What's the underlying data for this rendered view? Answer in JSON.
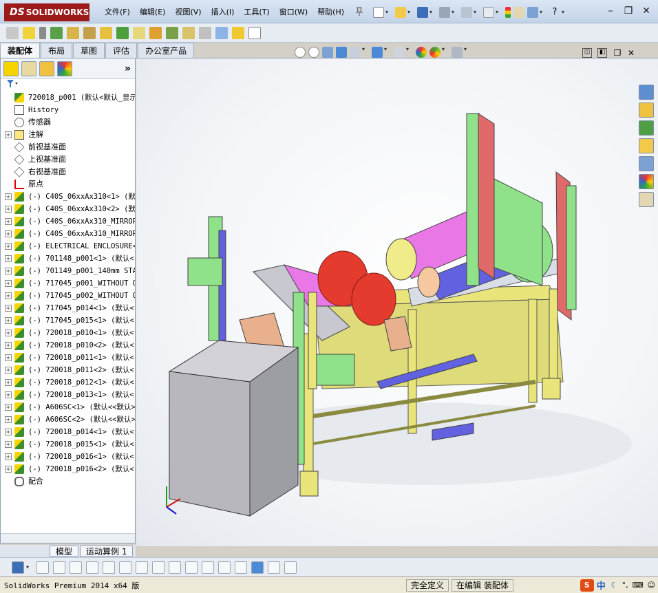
{
  "app": {
    "logo_text": "SOLIDWORKS",
    "menu": [
      "文件(F)",
      "编辑(E)",
      "视图(V)",
      "插入(I)",
      "工具(T)",
      "窗口(W)",
      "帮助(H)"
    ]
  },
  "tabs": [
    "装配体",
    "布局",
    "草图",
    "评估",
    "办公室产品"
  ],
  "tree": {
    "root_label": "720018_p001 (默认<默认_显示状",
    "items": [
      {
        "label": "History",
        "icon": "history-icon",
        "expand": ""
      },
      {
        "label": "传感器",
        "icon": "sensor-icon",
        "expand": ""
      },
      {
        "label": "注解",
        "icon": "annotation-icon",
        "expand": "+"
      },
      {
        "label": "前视基准面",
        "icon": "plane-icon",
        "expand": ""
      },
      {
        "label": "上视基准面",
        "icon": "plane-icon",
        "expand": ""
      },
      {
        "label": "右视基准面",
        "icon": "plane-icon",
        "expand": ""
      },
      {
        "label": "原点",
        "icon": "origin-icon",
        "expand": ""
      },
      {
        "label": "(-) C40S_06xxAx310<1> (默认",
        "icon": "part-icon",
        "expand": "+"
      },
      {
        "label": "(-) C40S_06xxAx310<2> (默认",
        "icon": "part-icon",
        "expand": "+"
      },
      {
        "label": "(-) C40S_06xxAx310_MIRROR<",
        "icon": "part-icon",
        "expand": "+"
      },
      {
        "label": "(-) C40S_06xxAx310_MIRROR<",
        "icon": "part-icon",
        "expand": "+"
      },
      {
        "label": "(-) ELECTRICAL ENCLOSURE<",
        "icon": "part-icon",
        "expand": "+"
      },
      {
        "label": "(-) 701148_p001<1> (默认<",
        "icon": "part-icon",
        "expand": "+"
      },
      {
        "label": "(-) 701149_p001_140mm STAC",
        "icon": "part-icon",
        "expand": "+"
      },
      {
        "label": "(-) 717045_p001_WITHOUT OI",
        "icon": "part-icon",
        "expand": "+"
      },
      {
        "label": "(-) 717045_p002_WITHOUT OI",
        "icon": "part-icon",
        "expand": "+"
      },
      {
        "label": "(-) 717045_p014<1> (默认<",
        "icon": "part-icon",
        "expand": "+"
      },
      {
        "label": "(-) 717045_p015<1> (默认<",
        "icon": "part-icon",
        "expand": "+"
      },
      {
        "label": "(-) 720018_p010<1> (默认<",
        "icon": "part-icon",
        "expand": "+"
      },
      {
        "label": "(-) 720018_p010<2> (默认<",
        "icon": "part-icon",
        "expand": "+"
      },
      {
        "label": "(-) 720018_p011<1> (默认<",
        "icon": "part-icon",
        "expand": "+"
      },
      {
        "label": "(-) 720018_p011<2> (默认<",
        "icon": "part-icon",
        "expand": "+"
      },
      {
        "label": "(-) 720018_p012<1> (默认<",
        "icon": "part-icon",
        "expand": "+"
      },
      {
        "label": "(-) 720018_p013<1> (默认<",
        "icon": "part-icon",
        "expand": "+"
      },
      {
        "label": "(-) A606SC<1> (默认<<默认>",
        "icon": "part-icon",
        "expand": "+"
      },
      {
        "label": "(-) A606SC<2> (默认<<默认>",
        "icon": "part-icon",
        "expand": "+"
      },
      {
        "label": "(-) 720018_p014<1> (默认<",
        "icon": "part-icon",
        "expand": "+"
      },
      {
        "label": "(-) 720018_p015<1> (默认<",
        "icon": "part-icon",
        "expand": "+"
      },
      {
        "label": "(-) 720018_p016<1> (默认<",
        "icon": "part-icon",
        "expand": "+"
      },
      {
        "label": "(-) 720018_p016<2> (默认<",
        "icon": "part-icon",
        "expand": "+"
      },
      {
        "label": "配合",
        "icon": "mates-icon",
        "expand": ""
      }
    ]
  },
  "bottom_tabs": [
    "模型",
    "运动算例 1"
  ],
  "status": {
    "product": "SolidWorks Premium 2014 x64 版",
    "fields": [
      "完全定义",
      "在编辑 装配体"
    ]
  },
  "ime": {
    "label": "中"
  },
  "colors": {
    "frame_yellow": "#e9e57a",
    "motor_pink": "#e978e6",
    "rotor_red": "#e53b2e",
    "plate_green": "#8fe28a",
    "cabinet_gray": "#b7b7bd",
    "blue_shaft": "#6262e0"
  }
}
